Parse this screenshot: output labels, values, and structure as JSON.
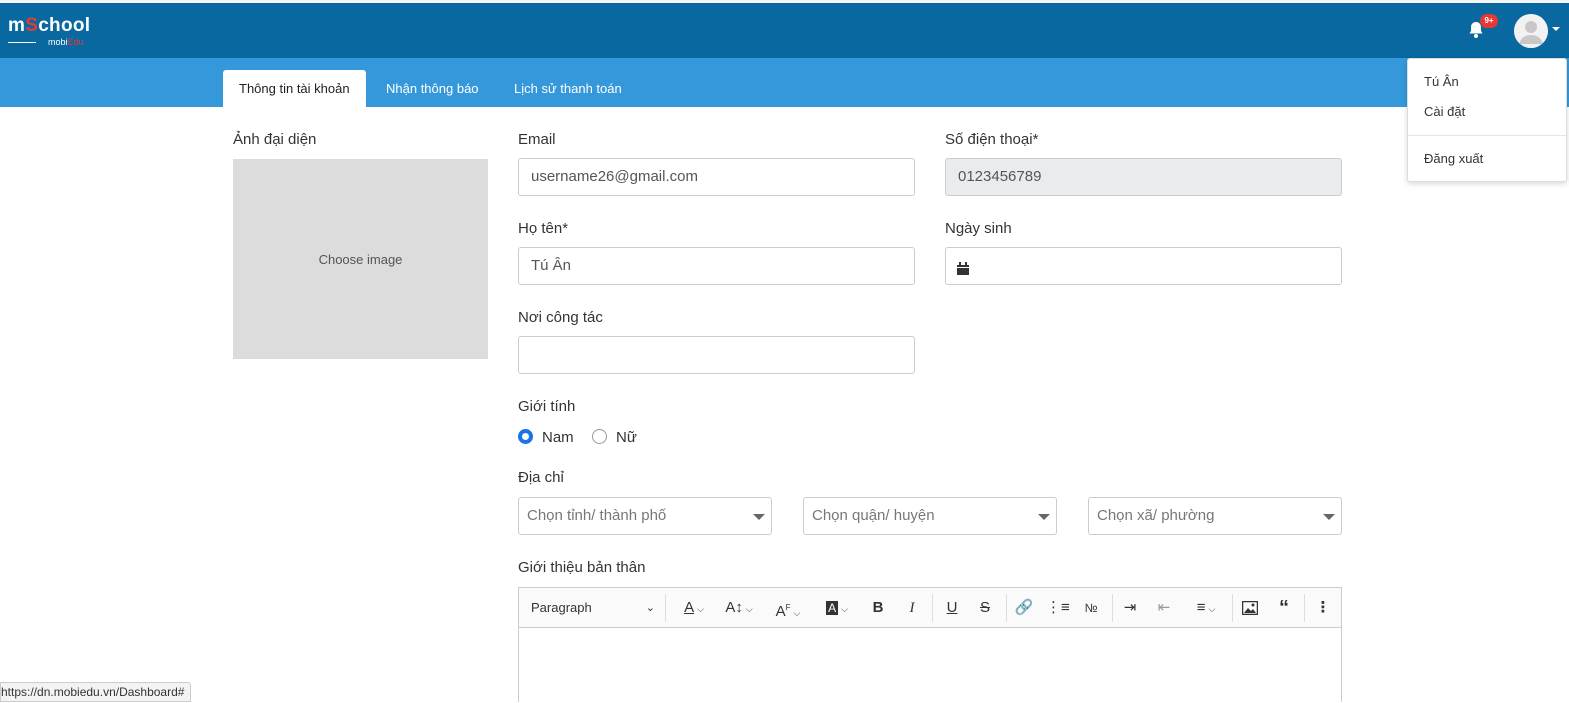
{
  "header": {
    "logo": {
      "main_pre": "m",
      "main_mid": "S",
      "main_post": "chool",
      "sub_pre": "mobi",
      "sub_post": "Edu"
    },
    "notification_badge": "9+"
  },
  "tabs": [
    {
      "label": "Thông tin tài khoản",
      "active": true
    },
    {
      "label": "Nhận thông báo",
      "active": false
    },
    {
      "label": "Lịch sử thanh toán",
      "active": false
    }
  ],
  "user_menu": {
    "name": "Tú Ân",
    "settings": "Cài đặt",
    "logout": "Đăng xuất"
  },
  "form": {
    "avatar_label": "Ảnh đại diện",
    "avatar_placeholder": "Choose image",
    "email_label": "Email",
    "email_value": "username26@gmail.com",
    "phone_label": "Số điện thoại*",
    "phone_value": "0123456789",
    "name_label": "Họ tên*",
    "name_value": "Tú Ân",
    "dob_label": "Ngày sinh",
    "dob_value": "",
    "workplace_label": "Nơi công tác",
    "workplace_value": "",
    "gender_label": "Giới tính",
    "gender_options": [
      "Nam",
      "Nữ"
    ],
    "gender_selected": "Nam",
    "address_label": "Địa chỉ",
    "province_placeholder": "Chọn tỉnh/ thành phố",
    "district_placeholder": "Chọn quận/ huyện",
    "ward_placeholder": "Chọn xã/ phường",
    "bio_label": "Giới thiệu bản thân"
  },
  "editor": {
    "paragraph_label": "Paragraph",
    "icons": [
      "font-color-icon",
      "font-size-icon",
      "font-family-icon",
      "highlight-icon",
      "bold-icon",
      "italic-icon",
      "underline-icon",
      "strikethrough-icon",
      "link-icon",
      "bulleted-list-icon",
      "numbered-list-icon",
      "indent-icon",
      "outdent-icon",
      "align-icon",
      "image-icon",
      "blockquote-icon",
      "more-icon"
    ]
  },
  "status_url": "https://dn.mobiedu.vn/Dashboard#",
  "colors": {
    "header": "#08689f",
    "tabbar": "#3498db",
    "accent": "#1a73e8",
    "badge": "#e53935"
  }
}
